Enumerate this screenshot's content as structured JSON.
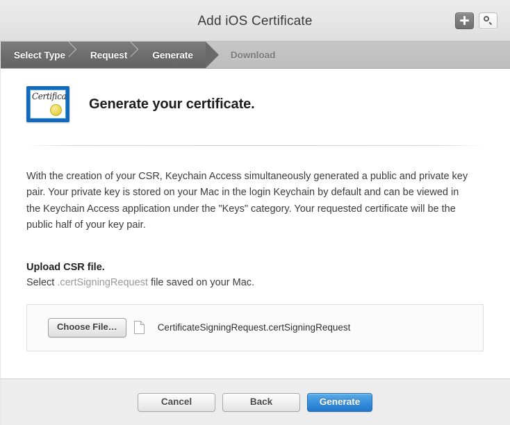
{
  "titlebar": {
    "title": "Add iOS Certificate",
    "actions": [
      {
        "name": "add-button",
        "icon": "plus-icon",
        "state": "active"
      },
      {
        "name": "search-button",
        "icon": "search-icon",
        "state": "default"
      }
    ]
  },
  "steps": [
    {
      "label": "Select Type",
      "state": "done"
    },
    {
      "label": "Request",
      "state": "done"
    },
    {
      "label": "Generate",
      "state": "current"
    },
    {
      "label": "Download",
      "state": "upcoming"
    }
  ],
  "hero": {
    "icon_label": "Certificate",
    "title": "Generate your certificate."
  },
  "body": {
    "paragraph": "With the creation of your CSR, Keychain Access simultaneously generated a public and private key pair. Your private key is stored on your Mac in the login Keychain by default and can be viewed in the Keychain Access application under the \"Keys\" category. Your requested certificate will be the public half of your key pair."
  },
  "upload": {
    "heading": "Upload CSR file.",
    "subtitle_before": "Select ",
    "subtitle_ext": ".certSigningRequest",
    "subtitle_after": " file saved on your Mac.",
    "choose_button": "Choose File…",
    "file_name": "CertificateSigningRequest.certSigningRequest"
  },
  "footer": {
    "cancel": "Cancel",
    "back": "Back",
    "generate": "Generate"
  },
  "colors": {
    "primary_button": "#2277cc",
    "cert_border": "#1569b8",
    "cert_seal": "#eddc62",
    "step_active": "#6c6c6c",
    "step_bar": "#bdbdbd"
  }
}
